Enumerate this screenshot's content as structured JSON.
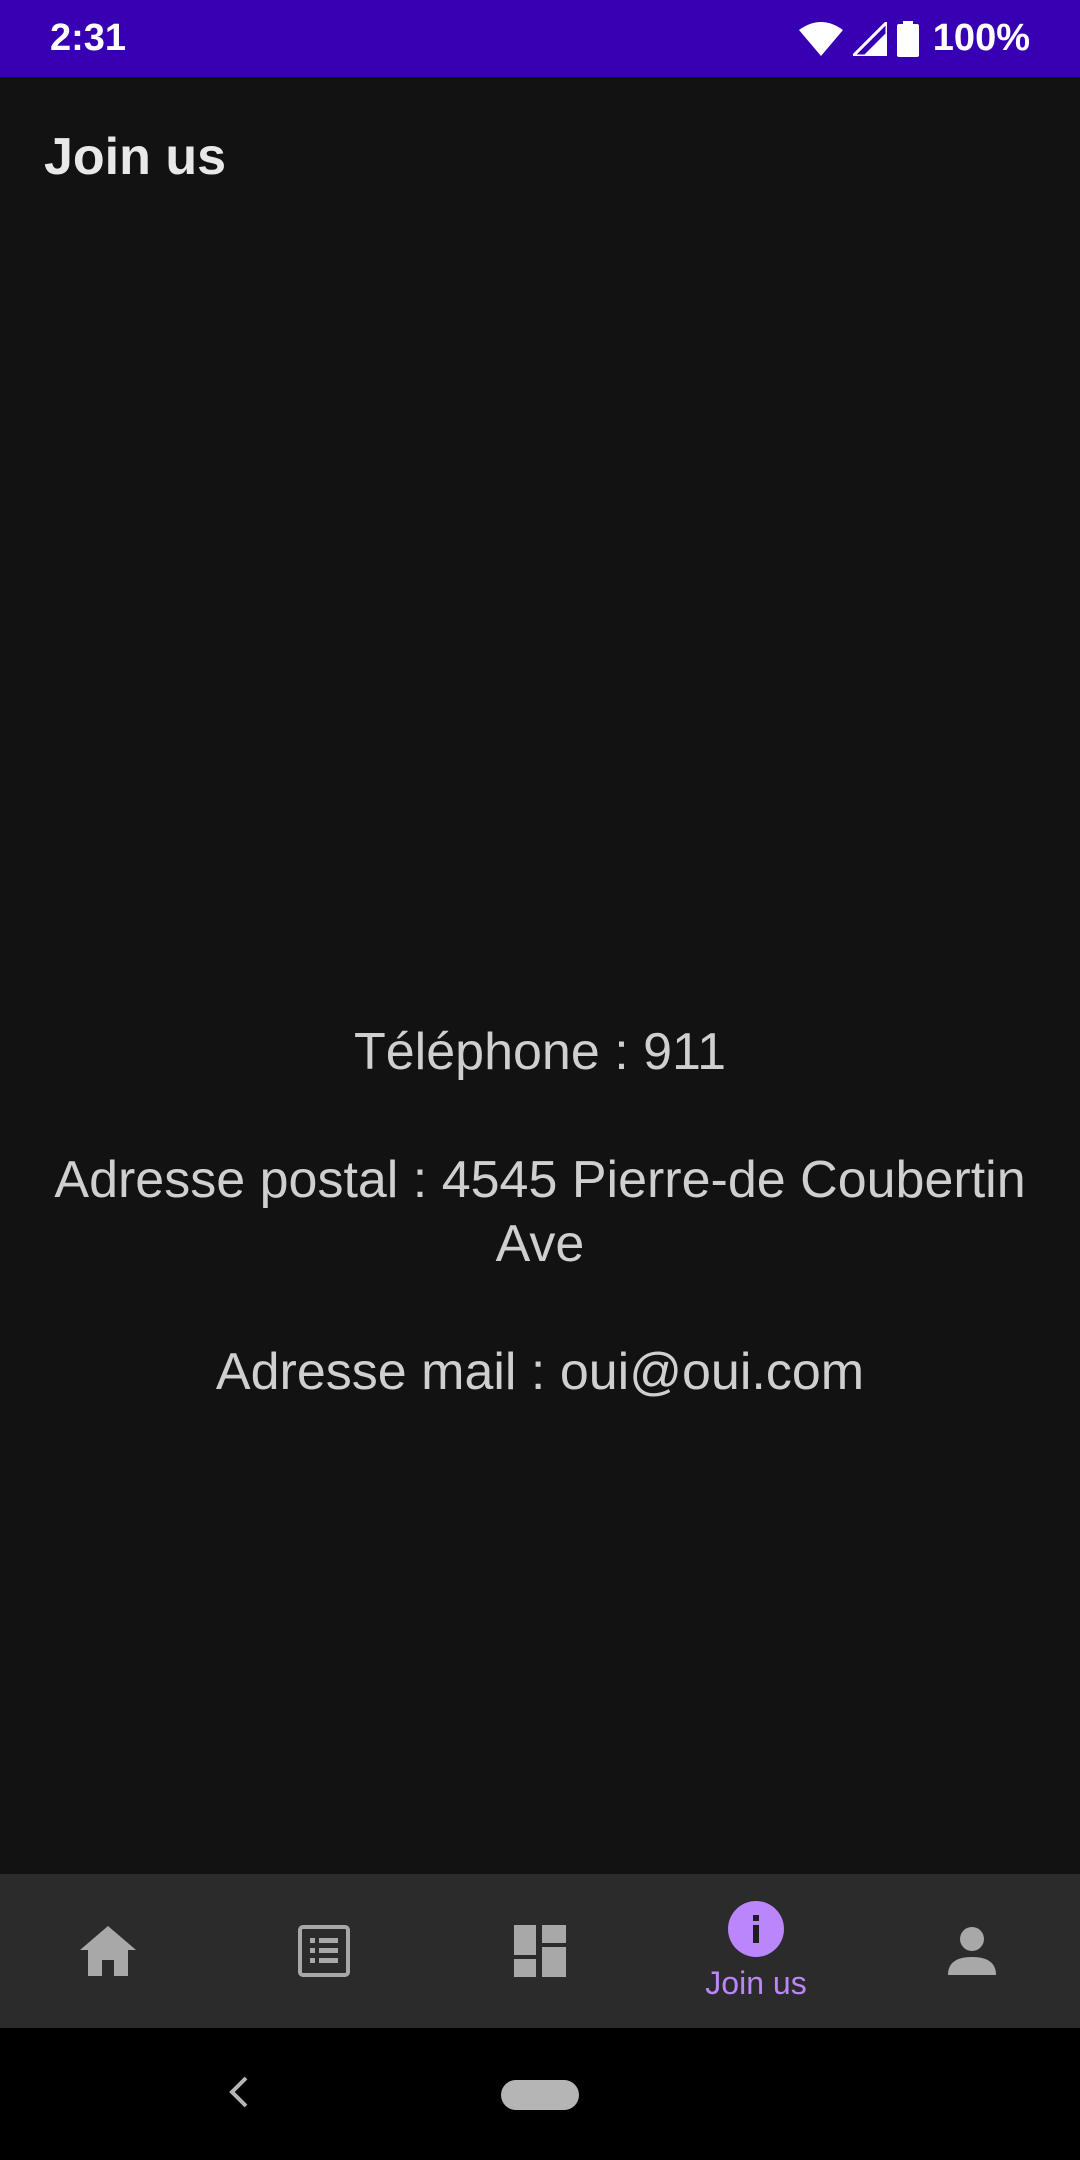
{
  "status_bar": {
    "time": "2:31",
    "battery": "100%",
    "icons": [
      "wifi-icon",
      "signal-icon",
      "battery-icon"
    ]
  },
  "app_bar": {
    "title": "Join us"
  },
  "contact": {
    "phone": "Téléphone : 911",
    "address_line1": "Adresse postal : 4545 Pierre-de Coubertin",
    "address_line2": "Ave",
    "email": "Adresse mail : oui@oui.com"
  },
  "bottom_nav": {
    "items": [
      {
        "icon": "home-icon",
        "label": ""
      },
      {
        "icon": "list-icon",
        "label": ""
      },
      {
        "icon": "dashboard-icon",
        "label": ""
      },
      {
        "icon": "info-icon",
        "label": "Join us",
        "selected": true
      },
      {
        "icon": "person-icon",
        "label": ""
      }
    ]
  },
  "colors": {
    "status_bar": "#3700b3",
    "background": "#121212",
    "nav_background": "#2b2b2b",
    "accent": "#bb86fc",
    "icon_inactive": "#a8a8a8"
  }
}
